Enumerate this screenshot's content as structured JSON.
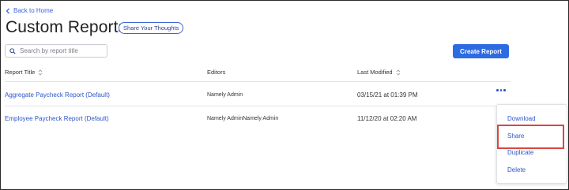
{
  "nav": {
    "back_label": "Back to Home"
  },
  "header": {
    "title": "Custom Reports",
    "share_thoughts_label": "Share Your Thoughts"
  },
  "search": {
    "placeholder": "Search by report title",
    "value": ""
  },
  "actions": {
    "create_report_label": "Create Report"
  },
  "table": {
    "columns": [
      "Report Title",
      "Editors",
      "Last Modified"
    ],
    "rows": [
      {
        "title": "Aggregate Paycheck Report (Default)",
        "editors": "Namely Admin",
        "modified": "03/15/21 at 01:39 PM"
      },
      {
        "title": "Employee Paycheck Report (Default)",
        "editors": "Namely AdminNamely Admin",
        "modified": "11/12/20 at 02:20 AM"
      }
    ]
  },
  "row_menu": {
    "items": [
      "Download",
      "Share",
      "Duplicate",
      "Delete"
    ],
    "highlighted": "Share"
  },
  "colors": {
    "accent": "#2d6be3",
    "link": "#2d55c8",
    "highlight": "#d9463e"
  },
  "icons": {
    "back": "chevron-left-icon",
    "search": "search-icon",
    "sort": "sort-icon",
    "more": "more-horizontal-icon"
  }
}
